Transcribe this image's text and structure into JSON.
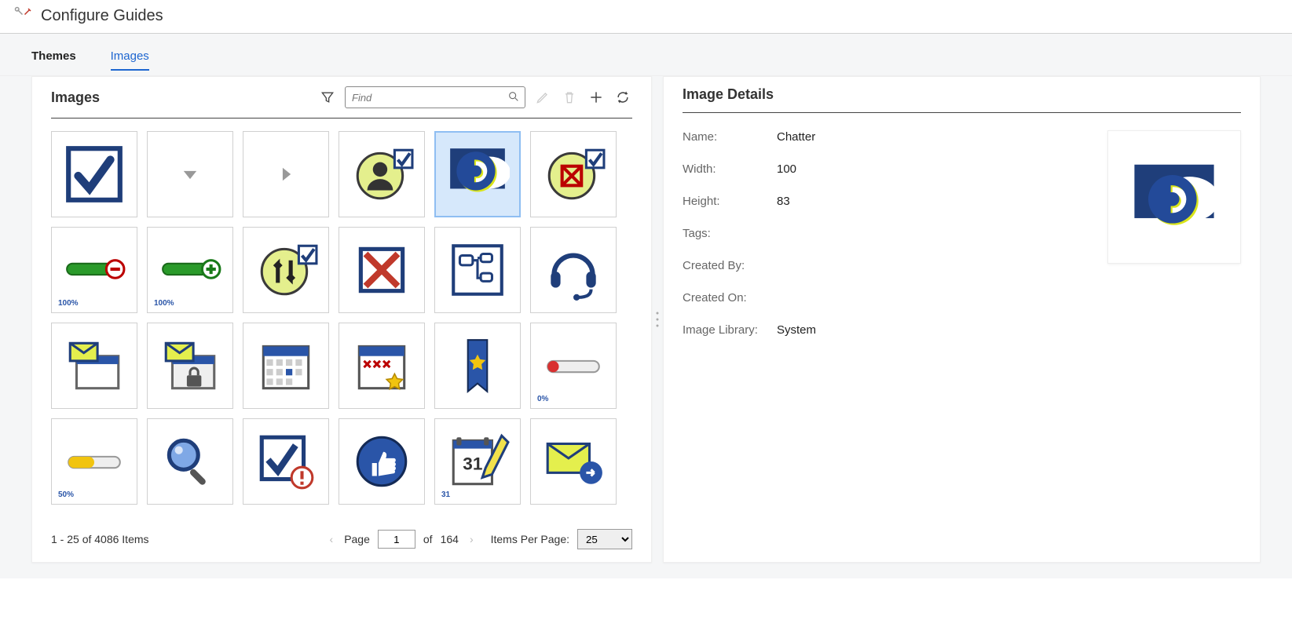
{
  "header": {
    "title": "Configure Guides"
  },
  "tabs": {
    "themes": "Themes",
    "images": "Images",
    "active": "images"
  },
  "toolbar": {
    "panel_title": "Images",
    "search_placeholder": "Find"
  },
  "grid": {
    "selected_index": 4,
    "items": [
      {
        "icon": "check"
      },
      {
        "icon": "caret-down"
      },
      {
        "icon": "caret-right"
      },
      {
        "icon": "avatar-check"
      },
      {
        "icon": "chatter-c"
      },
      {
        "icon": "cross-check"
      },
      {
        "icon": "progress-minus",
        "label": "100%"
      },
      {
        "icon": "progress-plus",
        "label": "100%"
      },
      {
        "icon": "arrows-check"
      },
      {
        "icon": "red-x"
      },
      {
        "icon": "org-chart"
      },
      {
        "icon": "headset"
      },
      {
        "icon": "mail-window"
      },
      {
        "icon": "mail-window-lock"
      },
      {
        "icon": "calendar"
      },
      {
        "icon": "calendar-star"
      },
      {
        "icon": "bookmark-star"
      },
      {
        "icon": "progress-red",
        "label": "0%"
      },
      {
        "icon": "progress-yellow",
        "label": "50%"
      },
      {
        "icon": "magnifier"
      },
      {
        "icon": "check-warn"
      },
      {
        "icon": "thumbs-up"
      },
      {
        "icon": "calendar-edit",
        "label": "31"
      },
      {
        "icon": "mail-forward"
      }
    ]
  },
  "footer": {
    "range": "1 - 25 of 4086 Items",
    "page_label": "Page",
    "page_value": "1",
    "of_label": "of",
    "total_pages": "164",
    "per_page_label": "Items Per Page:",
    "per_page_value": "25"
  },
  "details": {
    "title": "Image Details",
    "labels": {
      "name": "Name:",
      "width": "Width:",
      "height": "Height:",
      "tags": "Tags:",
      "created_by": "Created By:",
      "created_on": "Created On:",
      "library": "Image Library:"
    },
    "values": {
      "name": "Chatter",
      "width": "100",
      "height": "83",
      "tags": "",
      "created_by": "",
      "created_on": "",
      "library": "System"
    }
  }
}
